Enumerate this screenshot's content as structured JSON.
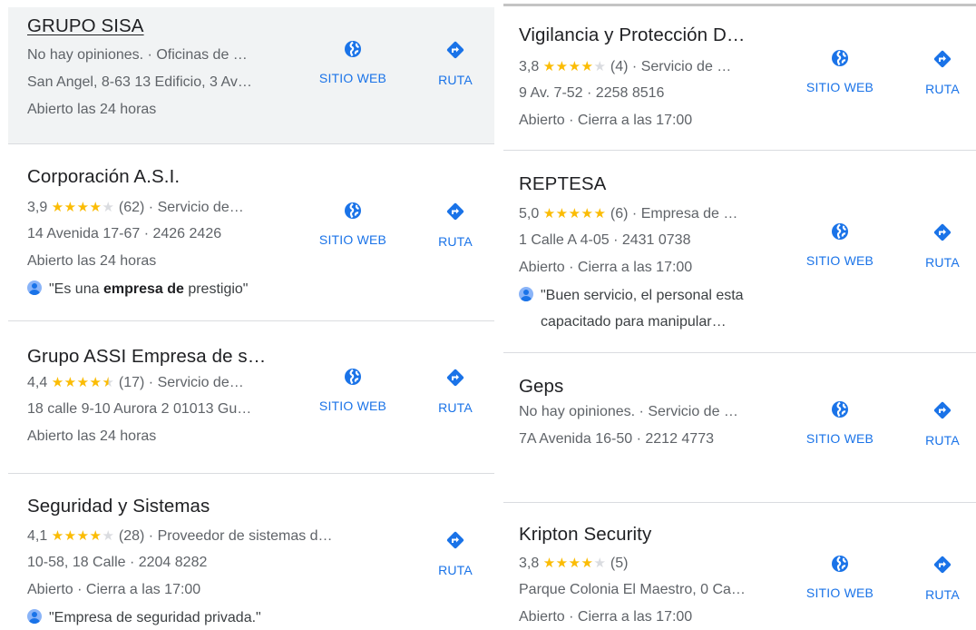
{
  "left": [
    {
      "name": "GRUPO SISA",
      "rating_text": "No hay opiniones.",
      "category": "Oficinas de …",
      "address": "San Angel, 8-63 13 Edificio, 3 Av…",
      "hours": "Abierto las 24 horas",
      "website_label": "SITIO WEB",
      "route_label": "RUTA"
    },
    {
      "name": "Corporación A.S.I.",
      "rating": "3,9",
      "stars": 4,
      "reviews": "(62)",
      "category": "Servicio de…",
      "address": "14 Avenida 17-67 · 2426 2426",
      "hours": "Abierto las 24 horas",
      "review_pre": "\"Es una ",
      "review_bold": "empresa de",
      "review_post": " prestigio\"",
      "website_label": "SITIO WEB",
      "route_label": "RUTA"
    },
    {
      "name": "Grupo ASSI Empresa de s…",
      "rating": "4,4",
      "stars": 4.5,
      "reviews": "(17)",
      "category": "Servicio de…",
      "address": "18 calle 9-10 Aurora 2 01013 Gu…",
      "hours": "Abierto las 24 horas",
      "website_label": "SITIO WEB",
      "route_label": "RUTA"
    },
    {
      "name": "Seguridad y Sistemas",
      "rating": "4,1",
      "stars": 4,
      "reviews": "(28)",
      "category": "Proveedor de sistemas d…",
      "address": "10-58, 18 Calle · 2204 8282",
      "hours": "Abierto · Cierra a las 17:00",
      "review_text": "\"Empresa de seguridad privada.\"",
      "route_label": "RUTA"
    }
  ],
  "right": [
    {
      "name": "Vigilancia y Protección D…",
      "rating": "3,8",
      "stars": 4,
      "reviews": "(4)",
      "category": "Servicio de …",
      "address": "9 Av. 7-52 · 2258 8516",
      "hours": "Abierto · Cierra a las 17:00",
      "website_label": "SITIO WEB",
      "route_label": "RUTA"
    },
    {
      "name": "REPTESA",
      "rating": "5,0",
      "stars": 5,
      "reviews": "(6)",
      "category": "Empresa de …",
      "address": "1 Calle A 4-05 · 2431 0738",
      "hours": "Abierto · Cierra a las 17:00",
      "review_line1": "\"Buen servicio, el personal esta",
      "review_line2": "capacitado para manipular…",
      "website_label": "SITIO WEB",
      "route_label": "RUTA"
    },
    {
      "name": "Geps",
      "rating_text": "No hay opiniones.",
      "category": "Servicio de …",
      "address": "7A Avenida 16-50 · 2212 4773",
      "website_label": "SITIO WEB",
      "route_label": "RUTA"
    },
    {
      "name": "Kripton Security",
      "rating": "3,8",
      "stars": 4,
      "reviews": "(5)",
      "address": "Parque Colonia El Maestro, 0 Ca…",
      "hours": "Abierto · Cierra a las 17:00",
      "website_label": "SITIO WEB",
      "route_label": "RUTA"
    }
  ],
  "colors": {
    "accent": "#1a73e8",
    "star": "#fbbc04",
    "highlight": "#f1f3f4"
  },
  "icons": {
    "website": "globe-icon",
    "route": "directions-icon"
  }
}
